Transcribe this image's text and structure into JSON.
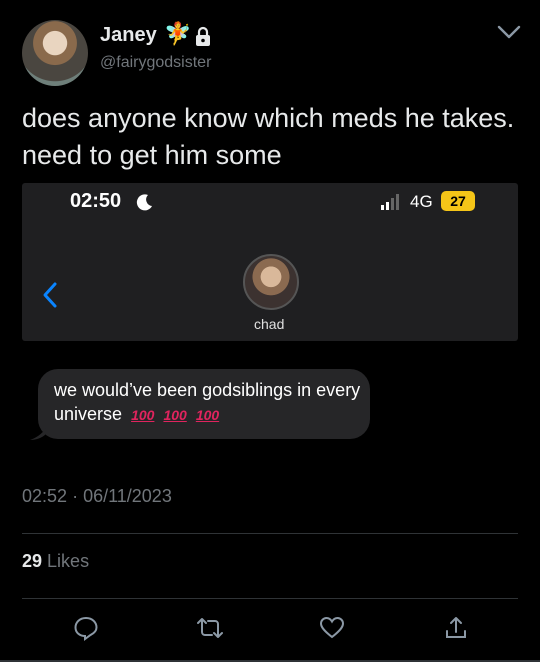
{
  "author": {
    "name": "Janey",
    "name_emoji": "🧚",
    "handle": "@fairygodsister"
  },
  "tweet": {
    "text": "does anyone know which meds he takes. need to get him some"
  },
  "screenshot": {
    "status_time": "02:50",
    "network": "4G",
    "battery": "27",
    "contact_name": "chad",
    "message_text": "we would’ve been godsiblings in every universe",
    "message_emojis": [
      "100",
      "100",
      "100"
    ]
  },
  "meta": {
    "time": "02:52",
    "separator": "·",
    "date": "06/11/2023"
  },
  "likes": {
    "count": "29",
    "label": "Likes"
  },
  "icons": [
    "lock-icon",
    "chevron-down-icon",
    "moon-icon",
    "signal-icon",
    "back-chevron-icon",
    "reply-icon",
    "retweet-icon",
    "like-icon",
    "share-icon"
  ],
  "colors": {
    "background": "#000000",
    "muted": "#71767b",
    "text": "#e7e9ea",
    "battery": "#f5c518",
    "ios_blue": "#0a84ff",
    "hundred_red": "#e0245e"
  }
}
